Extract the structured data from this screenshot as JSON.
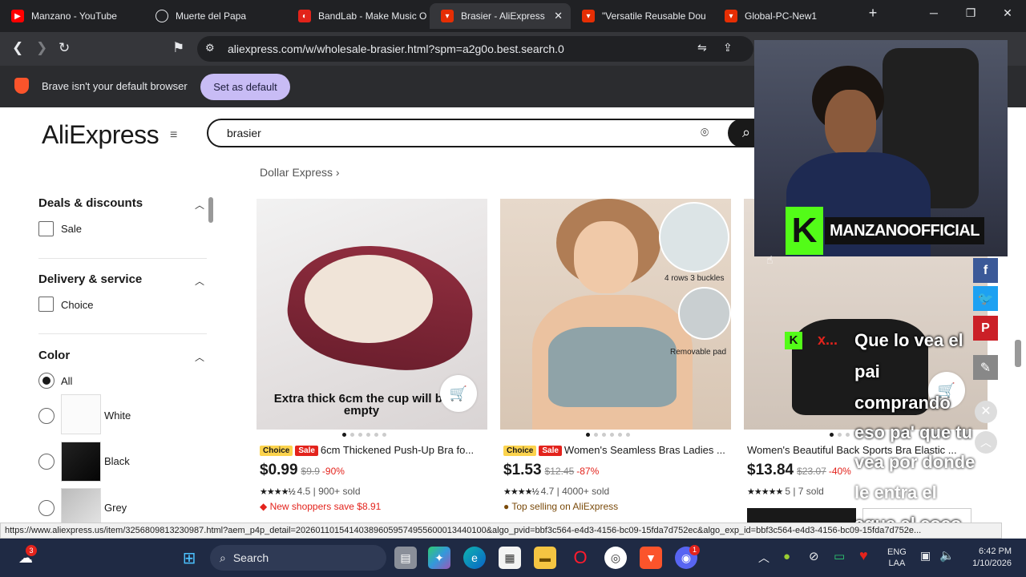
{
  "tabs": [
    {
      "label": "Manzano - YouTube",
      "color": "#ff0000",
      "icon": "youtube-icon"
    },
    {
      "label": "Muerte del Papa",
      "color": "#9aa0a6",
      "icon": "chatgpt-icon"
    },
    {
      "label": "BandLab - Make Music O",
      "color": "#e2231a",
      "icon": "bandlab-icon"
    },
    {
      "label": "Brasier - AliExpress",
      "color": "#e62e04",
      "icon": "aliexpress-icon"
    },
    {
      "label": "\"Versatile Reusable Dou",
      "color": "#e62e04",
      "icon": "aliexpress-icon"
    },
    {
      "label": "Global-PC-New1",
      "color": "#e62e04",
      "icon": "aliexpress-icon"
    }
  ],
  "address": {
    "url": "aliexpress.com/w/wholesale-brasier.html?spm=a2g0o.best.search.0"
  },
  "infobar": {
    "message": "Brave isn't your default browser",
    "button": "Set as default"
  },
  "site": {
    "logo": "AliExpress",
    "search_value": "brasier",
    "breadcrumb": "Dollar Express"
  },
  "filters": {
    "deals": {
      "title": "Deals & discounts",
      "options": [
        "Sale"
      ]
    },
    "delivery": {
      "title": "Delivery & service",
      "options": [
        "Choice"
      ]
    },
    "color": {
      "title": "Color",
      "all": "All",
      "options": [
        "White",
        "Black",
        "Grey"
      ]
    }
  },
  "products": [
    {
      "image_text": "Extra thick 6cm the cup will be empty",
      "badges": [
        "Choice",
        "Sale"
      ],
      "title": "6cm Thickened Push-Up Bra fo...",
      "price": "$0.99",
      "old_price": "$9.9",
      "discount": "-90%",
      "rating": "4.5",
      "sold": "900+ sold",
      "promo": "New shoppers save $8.91"
    },
    {
      "image_text": "4 rows 3 buckles",
      "image_text2": "Removable pad",
      "badges": [
        "Choice",
        "Sale"
      ],
      "title": "Women's Seamless Bras Ladies ...",
      "price": "$1.53",
      "old_price": "$12.45",
      "discount": "-87%",
      "rating": "4.7",
      "sold": "4000+ sold",
      "promo": "Top selling on AliExpress"
    },
    {
      "badges": [],
      "title": "Women's Beautiful Back Sports Bra Elastic ...",
      "price": "$13.84",
      "old_price": "$23.07",
      "discount": "-40%",
      "rating": "5",
      "sold": "7 sold",
      "promo": ""
    }
  ],
  "status_url": "https://www.aliexpress.us/item/3256809813230987.html?aem_p4p_detail=202601101541403896059574955600013440100&algo_pvid=bbf3c564-e4d3-4156-bc09-15fda7d752ec&algo_exp_id=bbf3c564-e4d3-4156-bc09-15fda7d752e...",
  "taskbar": {
    "search": "Search",
    "lang": "ENG",
    "lang2": "LAA",
    "time": "6:42 PM",
    "date": "1/10/2026",
    "weather_badge": "3",
    "discord_badge": "1"
  },
  "stream": {
    "tag": "MANZANOOFFICIAL",
    "chat_user": "x...",
    "caption_lines": [
      "Que lo vea el",
      "pai",
      "comprando",
      "eso pa' que tu",
      "vea por donde",
      "le entra el",
      "agua al coco"
    ]
  },
  "colors": {
    "accent": "#e62e04",
    "brave_button": "#c8bcf5",
    "sale": "#e3231c",
    "choice": "#fcd34d",
    "kick_green": "#53fc18"
  }
}
